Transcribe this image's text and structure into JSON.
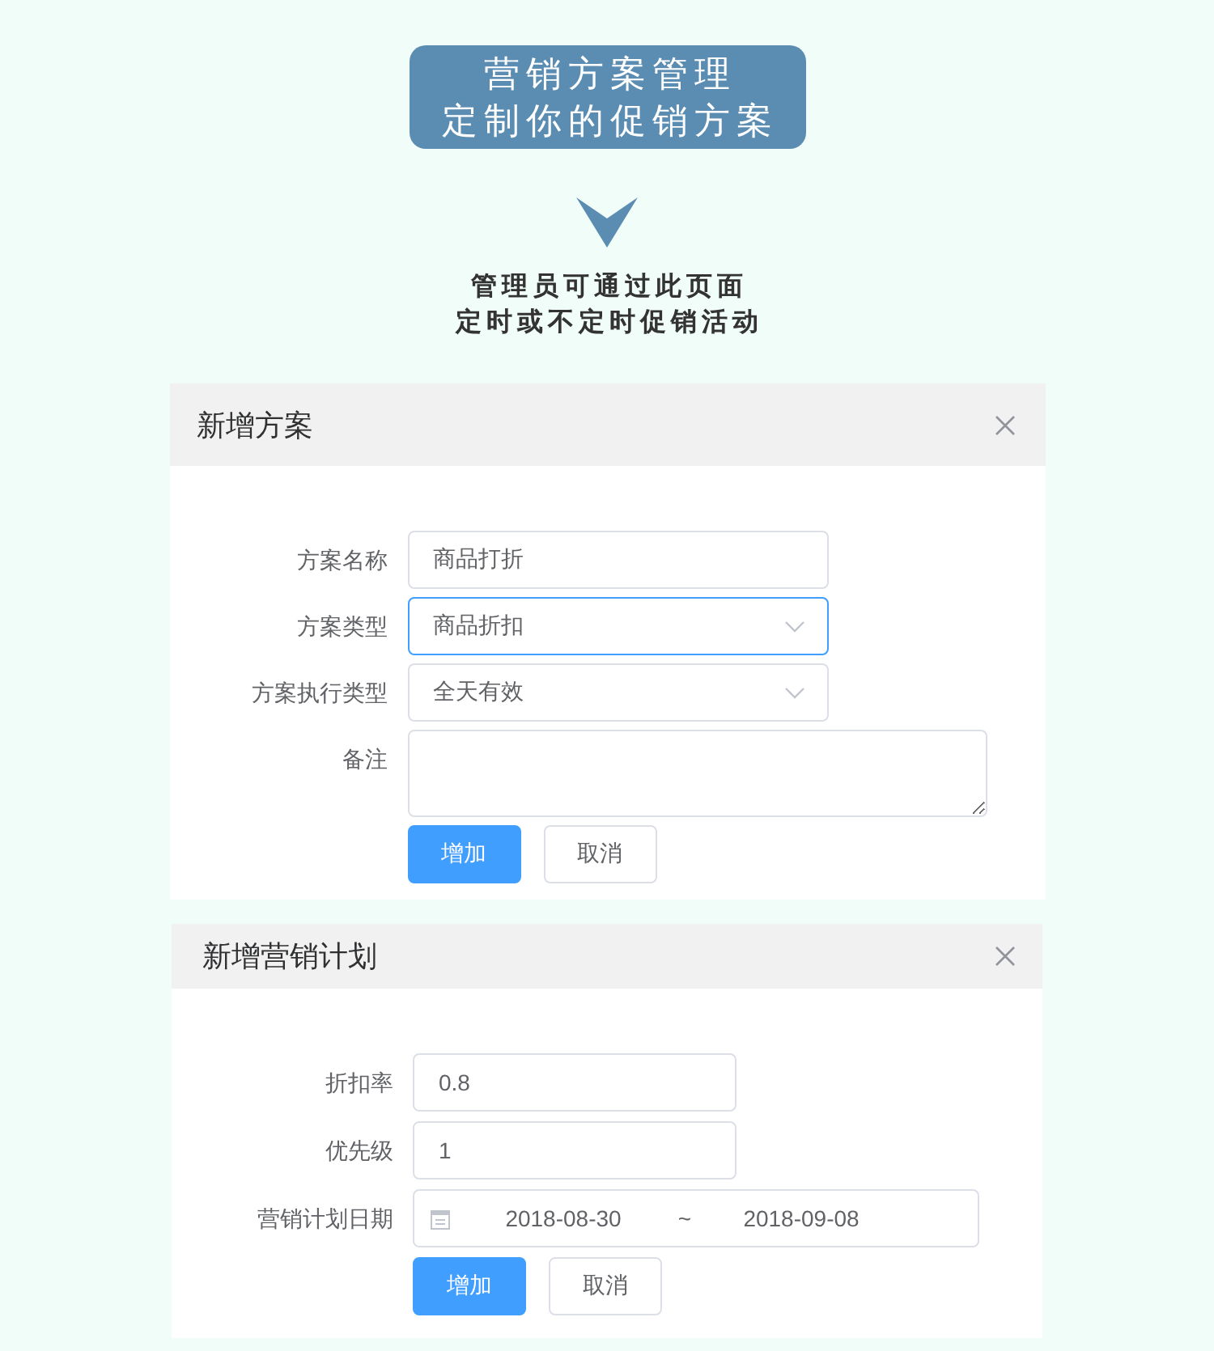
{
  "banner": {
    "lines": [
      "营销方案管理",
      "定制你的促销方案"
    ]
  },
  "intro": {
    "lines": [
      "管理员可通过此页面",
      "定时或不定时促销活动"
    ]
  },
  "panels": [
    {
      "title": "新增方案",
      "fields": [
        {
          "kind": "text",
          "label": "方案名称",
          "value": "商品打折",
          "focused": false
        },
        {
          "kind": "select",
          "label": "方案类型",
          "value": "商品折扣",
          "focused": true
        },
        {
          "kind": "select",
          "label": "方案执行类型",
          "value": "全天有效",
          "focused": false
        },
        {
          "kind": "textarea",
          "label": "备注",
          "focused": false
        }
      ],
      "buttons": [
        {
          "kind": "primary",
          "label": "增加"
        },
        {
          "kind": "plain",
          "label": "取消"
        }
      ]
    },
    {
      "title": "新增营销计划",
      "fields": [
        {
          "kind": "text",
          "label": "折扣率",
          "value": "0.8",
          "focused": false
        },
        {
          "kind": "text",
          "label": "优先级",
          "value": "1",
          "focused": false
        },
        {
          "kind": "daterange",
          "label": "营销计划日期",
          "start": "2018-08-30",
          "separator": "~",
          "end": "2018-09-08",
          "focused": false
        }
      ],
      "buttons": [
        {
          "kind": "primary",
          "label": "增加"
        },
        {
          "kind": "plain",
          "label": "取消"
        }
      ]
    }
  ]
}
